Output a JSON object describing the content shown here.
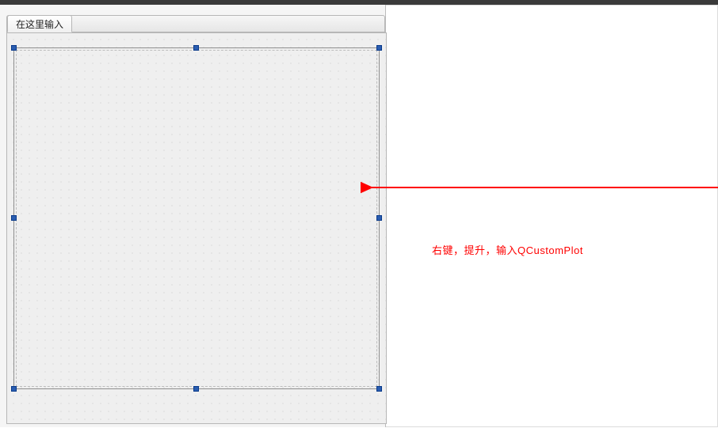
{
  "designer": {
    "tab_label": "在这里输入"
  },
  "annotation": {
    "text": "右键，提升，输入QCustomPlot",
    "arrow_color": "#ff0000"
  }
}
